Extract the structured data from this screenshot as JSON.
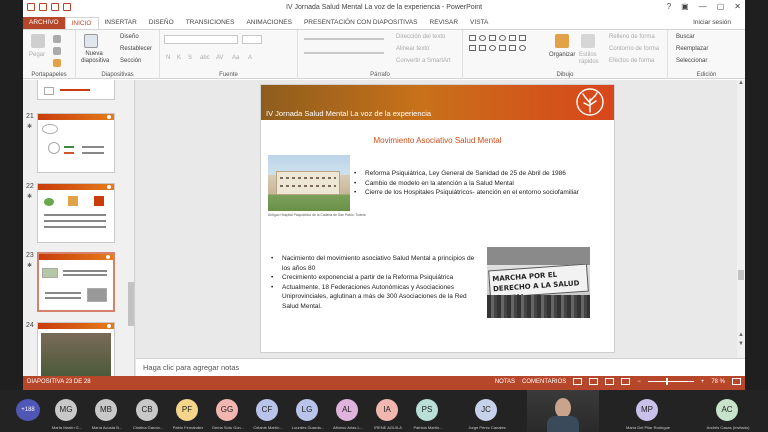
{
  "window": {
    "title": "IV Jornada Salud Mental La voz de la experiencia - PowerPoint",
    "controls": [
      "?",
      "▣",
      "—",
      "▢",
      "✕"
    ]
  },
  "ribbon_tabs": [
    "ARCHIVO",
    "INICIO",
    "INSERTAR",
    "DISEÑO",
    "TRANSICIONES",
    "ANIMACIONES",
    "PRESENTACIÓN CON DIAPOSITIVAS",
    "REVISAR",
    "VISTA"
  ],
  "signin": "Iniciar sesión",
  "ribbon": {
    "portapapeles": {
      "label": "Portapapeles",
      "paste": "Pegar"
    },
    "diapositivas": {
      "label": "Diapositivas",
      "new_slide": "Nueva diapositiva",
      "layout": "Diseño",
      "reset": "Restablecer",
      "section": "Sección"
    },
    "fuente": {
      "label": "Fuente",
      "styles": [
        "N",
        "K",
        "S",
        "abc",
        "AV",
        "Aa",
        "A"
      ]
    },
    "parrafo": {
      "label": "Párrafo",
      "text_direction": "Dirección del texto",
      "align_text": "Alinear texto",
      "smartart": "Convertir a SmartArt"
    },
    "dibujo": {
      "label": "Dibujo",
      "arrange": "Organizar",
      "quick_styles": "Estilos rápidos",
      "fill": "Relleno de forma",
      "outline": "Contorno de forma",
      "effects": "Efectos de forma"
    },
    "edicion": {
      "label": "Edición",
      "find": "Buscar",
      "replace": "Reemplazar",
      "select": "Seleccionar"
    }
  },
  "thumbnails": [
    {
      "number": "21",
      "star": "✱"
    },
    {
      "number": "22",
      "star": "✱"
    },
    {
      "number": "23",
      "star": "✱"
    },
    {
      "number": "24",
      "star": ""
    }
  ],
  "slide": {
    "title": "IV Jornada Salud Mental La voz de la experiencia",
    "heading": "Movimiento Asociativo Salud Mental",
    "photo1_caption": "Antiguo Hospital Psiquiátrico de la Cadena de San Pablo, Tudela",
    "bullets_top": [
      "Reforma Psiquiátrica, Ley General de Sanidad de 25 de Abril de 1986",
      "Cambio de modelo en la atención a la Salud Mental",
      "Cierre de los Hospitales Psiquiátricos- atención en el entorno sociofamiliar"
    ],
    "bullets_bottom": [
      "Nacimiento del movimiento asociativo Salud Mental a principios de los años 80",
      "Crecimiento exponencial a partir de la Reforma Psiquiátrica",
      "Actualmente, 18 Federaciones Autonómicas y Asociaciones Uniprovinciales, aglutinan a más de 300 Asociaciones de la Red Salud Mental."
    ],
    "banner_text": "MARCHA POR EL DERECHO A LA SALUD MENTAL"
  },
  "notes_placeholder": "Haga clic para agregar notas",
  "status": {
    "slide_count": "DIAPOSITIVA 23 DE 28",
    "notes": "NOTAS",
    "comments": "COMENTARIOS",
    "zoom": "78 %"
  },
  "meeting": {
    "more_count": "+188",
    "participants": [
      {
        "initials": "MG",
        "name": "Marta Martín G...",
        "color": "#c8c8c8"
      },
      {
        "initials": "MB",
        "name": "María Acosta B...",
        "color": "#c8c8c8"
      },
      {
        "initials": "CB",
        "name": "Cristina García...",
        "color": "#c8c8c8"
      },
      {
        "initials": "PF",
        "name": "Pablo Fernández",
        "color": "#f4d58a"
      },
      {
        "initials": "GG",
        "name": "Gema Soto Gon...",
        "color": "#f1b6b0"
      },
      {
        "initials": "CF",
        "name": "Celanie Martín...",
        "color": "#b9c4ea"
      },
      {
        "initials": "LG",
        "name": "Lourdes Guarda...",
        "color": "#b9c4ea"
      },
      {
        "initials": "AL",
        "name": "Alfonso Arias L...",
        "color": "#e0b3dc"
      },
      {
        "initials": "IA",
        "name": "IRENE AGUILA",
        "color": "#f1b6b0"
      },
      {
        "initials": "PS",
        "name": "Patricia Martín...",
        "color": "#b8e0d6"
      },
      {
        "initials": "JC",
        "name": "Jorge Pérez Canales",
        "color": "#c6d2ea"
      },
      {
        "initials": "MP",
        "name": "María Del Pilar Rodríguez Pérez",
        "color": "#c9c1ea"
      },
      {
        "initials": "AC",
        "name": "Andrés Casas (Invitado)",
        "color": "#c7e3c9"
      }
    ]
  },
  "colors": {
    "accent": "#b7472a",
    "slide_heading": "#c8501b",
    "header_gradient_start": "#8e5d1d",
    "header_gradient_end": "#d8461b"
  }
}
